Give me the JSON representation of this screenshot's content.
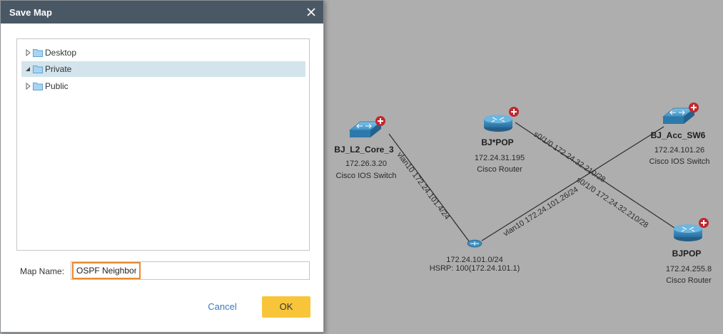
{
  "dialog": {
    "title": "Save Map",
    "close_icon": "close-icon",
    "tree": {
      "items": [
        {
          "label": "Desktop",
          "expanded": false,
          "selected": false
        },
        {
          "label": "Private",
          "expanded": true,
          "selected": true
        },
        {
          "label": "Public",
          "expanded": false,
          "selected": false
        }
      ]
    },
    "map_name_label": "Map Name:",
    "map_name_value": "OSPF Neighbor",
    "cancel_label": "Cancel",
    "ok_label": "OK"
  },
  "topology": {
    "devices": {
      "bj_l2_core_3": {
        "name": "BJ_L2_Core_3",
        "ip": "172.26.3.20",
        "type": "Cisco IOS Switch",
        "icon": "switch-icon"
      },
      "bj_star_pop": {
        "name": "BJ*POP",
        "ip": "172.24.31.195",
        "type": "Cisco Router",
        "icon": "router-icon"
      },
      "bj_acc_sw6": {
        "name": "BJ_Acc_SW6",
        "ip": "172.24.101.26",
        "type": "Cisco IOS Switch",
        "icon": "switch-icon"
      },
      "bjpop": {
        "name": "BJPOP",
        "ip": "172.24.255.8",
        "type": "Cisco Router",
        "icon": "router-icon"
      }
    },
    "subnet": {
      "name": "172.24.101.0/24",
      "hsrp": "HSRP: 100(172.24.101.1)",
      "icon": "subnet-icon"
    },
    "links": {
      "core_to_subnet": "vlan10 172.24.101.4/24",
      "subnet_to_acc": "vlan10 172.24.101.26/24",
      "starpop_to_bjpop_1": "s0/1/0 172.24.32.210/28",
      "starpop_to_bjpop_2": "s0/1/0 172.24.32.210/28"
    },
    "colors": {
      "background": "#aeaeae",
      "device_icon": "#3f8fbf",
      "expand_badge": "#c0282d",
      "link": "#2b2b2b",
      "dialog_header": "#4a5866",
      "selection": "#d3e4ed",
      "ok_button": "#f8c53a",
      "input_highlight": "#e8892f",
      "cancel_link": "#3c7ab8"
    }
  }
}
